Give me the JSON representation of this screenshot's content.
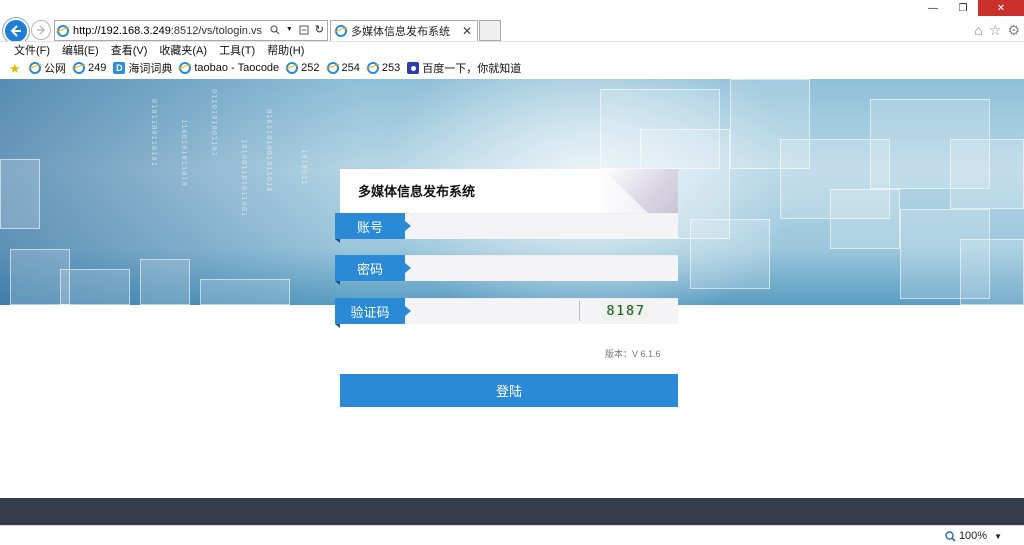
{
  "browser": {
    "url": "http://192.168.3.249:8512/vs/tologin.vs",
    "url_host": "http://192.168.3.249",
    "url_rest": ":8512/vs/tologin.vs",
    "tab_title": "多媒体信息发布系统",
    "menu": [
      "文件(F)",
      "编辑(E)",
      "查看(V)",
      "收藏夹(A)",
      "工具(T)",
      "帮助(H)"
    ],
    "favorites": [
      {
        "label": "公网",
        "icon": "ie-icon"
      },
      {
        "label": "249",
        "icon": "ie-icon"
      },
      {
        "label": "海词词典",
        "icon": "dict-icon"
      },
      {
        "label": "taobao - Taocode",
        "icon": "ie-icon"
      },
      {
        "label": "252",
        "icon": "ie-icon"
      },
      {
        "label": "254",
        "icon": "ie-icon"
      },
      {
        "label": "253",
        "icon": "ie-icon"
      },
      {
        "label": "百度一下，你就知道",
        "icon": "baidu-icon"
      }
    ],
    "zoom": "100%"
  },
  "login": {
    "title": "多媒体信息发布系统",
    "account_label": "账号",
    "password_label": "密码",
    "captcha_label": "验证码",
    "captcha_code": "8187",
    "version": "版本：V 6.1.6",
    "submit_label": "登陆"
  },
  "colors": {
    "accent": "#2a8ad6",
    "footer": "#363c49",
    "close": "#c9302c"
  }
}
